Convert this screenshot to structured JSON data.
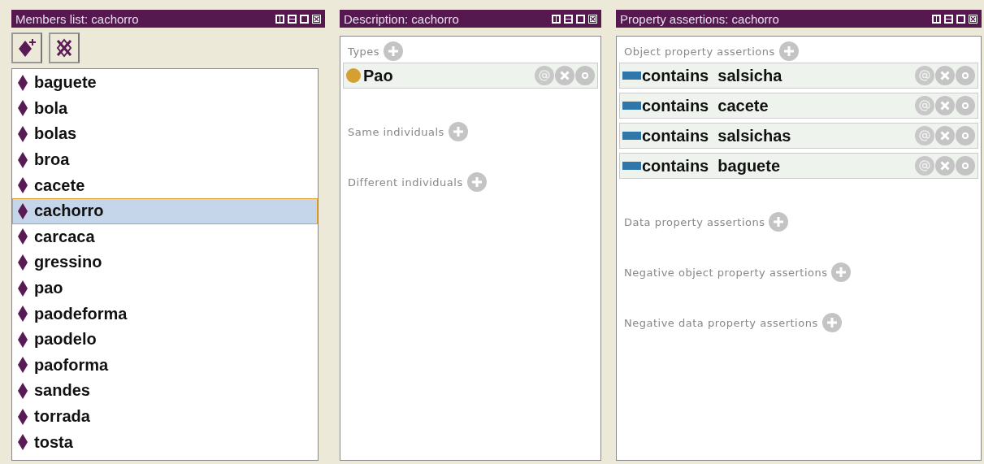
{
  "members_panel": {
    "title": "Members list: cachorro",
    "items": [
      {
        "label": "baguete",
        "selected": false
      },
      {
        "label": "bola",
        "selected": false
      },
      {
        "label": "bolas",
        "selected": false
      },
      {
        "label": "broa",
        "selected": false
      },
      {
        "label": "cacete",
        "selected": false
      },
      {
        "label": "cachorro",
        "selected": true
      },
      {
        "label": "carcaca",
        "selected": false
      },
      {
        "label": "gressino",
        "selected": false
      },
      {
        "label": "pao",
        "selected": false
      },
      {
        "label": "paodeforma",
        "selected": false
      },
      {
        "label": "paodelo",
        "selected": false
      },
      {
        "label": "paoforma",
        "selected": false
      },
      {
        "label": "sandes",
        "selected": false
      },
      {
        "label": "torrada",
        "selected": false
      },
      {
        "label": "tosta",
        "selected": false
      }
    ]
  },
  "description_panel": {
    "title": "Description: cachorro",
    "sections": [
      {
        "label": "Types",
        "items": [
          {
            "label": "Pao"
          }
        ]
      },
      {
        "label": "Same individuals"
      },
      {
        "label": "Different individuals"
      }
    ]
  },
  "property_panel": {
    "title": "Property assertions: cachorro",
    "sections": [
      {
        "label": "Object property assertions",
        "items": [
          {
            "property": "contains",
            "value": "salsicha"
          },
          {
            "property": "contains",
            "value": "cacete"
          },
          {
            "property": "contains",
            "value": "salsichas"
          },
          {
            "property": "contains",
            "value": "baguete"
          }
        ]
      },
      {
        "label": "Data property assertions"
      },
      {
        "label": "Negative object property assertions"
      },
      {
        "label": "Negative data property assertions"
      }
    ]
  }
}
